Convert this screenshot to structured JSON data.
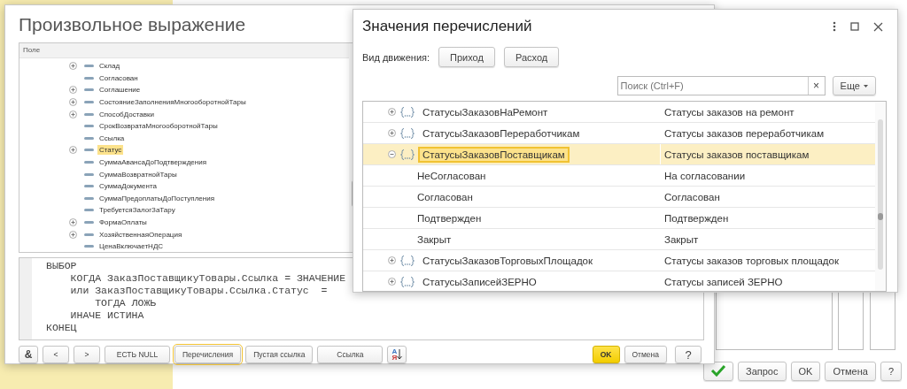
{
  "background_window": {
    "buttons": [
      {
        "kind": "check"
      },
      {
        "kind": "text",
        "label": "Запрос"
      },
      {
        "kind": "text",
        "label": "OK"
      },
      {
        "kind": "text",
        "label": "Отмена"
      },
      {
        "kind": "text",
        "label": "?"
      }
    ]
  },
  "expression_dialog": {
    "title": "Произвольное выражение",
    "tree": {
      "column": "Поле",
      "items": [
        {
          "label": "Склад",
          "expandable": true,
          "selected": false
        },
        {
          "label": "Согласован",
          "expandable": false,
          "selected": false
        },
        {
          "label": "Соглашение",
          "expandable": true,
          "selected": false
        },
        {
          "label": "СостояниеЗаполненияМногооборотнойТары",
          "expandable": true,
          "selected": false
        },
        {
          "label": "СпособДоставки",
          "expandable": true,
          "selected": false
        },
        {
          "label": "СрокВозвратаМногооборотнойТары",
          "expandable": false,
          "selected": false
        },
        {
          "label": "Ссылка",
          "expandable": false,
          "selected": false
        },
        {
          "label": "Статус",
          "expandable": true,
          "selected": true
        },
        {
          "label": "СуммаАвансаДоПодтверждения",
          "expandable": false,
          "selected": false
        },
        {
          "label": "СуммаВозвратнойТары",
          "expandable": false,
          "selected": false
        },
        {
          "label": "СуммаДокумента",
          "expandable": false,
          "selected": false
        },
        {
          "label": "СуммаПредоплатыДоПоступления",
          "expandable": false,
          "selected": false
        },
        {
          "label": "ТребуетсяЗалогЗаТару",
          "expandable": false,
          "selected": false
        },
        {
          "label": "ФормаОплаты",
          "expandable": true,
          "selected": false
        },
        {
          "label": "ХозяйственнаяОперация",
          "expandable": true,
          "selected": false
        },
        {
          "label": "ЦенаВключаетНДС",
          "expandable": false,
          "selected": false
        }
      ]
    },
    "code_lines": [
      "ВЫБОР",
      "    КОГДА ЗаказПоставщикуТовары.Ссылка = ЗНАЧЕНИЕ",
      "    или ЗаказПоставщикуТовары.Ссылка.Статус  =",
      "        ТОГДА ЛОЖЬ",
      "    ИНАЧЕ ИСТИНА",
      "КОНЕЦ"
    ],
    "toolbar": [
      {
        "kind": "text",
        "label": "&",
        "focused": false
      },
      {
        "kind": "text",
        "label": "<",
        "focused": false
      },
      {
        "kind": "text",
        "label": ">",
        "focused": false
      },
      {
        "kind": "text",
        "label": "ЕСТЬ NULL",
        "focused": false
      },
      {
        "kind": "text",
        "label": "Перечисления",
        "focused": true
      },
      {
        "kind": "text",
        "label": "Пустая ссылка",
        "focused": false
      },
      {
        "kind": "text",
        "label": "Ссылка",
        "focused": false
      },
      {
        "kind": "sort",
        "letters": [
          "А",
          "Я"
        ],
        "focused": false
      }
    ],
    "footer_buttons": [
      {
        "label": "OK",
        "default": true
      },
      {
        "label": "Отмена",
        "default": false
      },
      {
        "label": "?",
        "default": false
      }
    ]
  },
  "enum_dialog": {
    "title": "Значения перечислений",
    "filter_label": "Вид движения:",
    "filter_buttons": [
      "Приход",
      "Расход"
    ],
    "search": {
      "placeholder": "Поиск (Ctrl+F)"
    },
    "clear": "×",
    "more": "Еще",
    "rows": [
      {
        "name": "СтатусыЗаказовНаРемонт",
        "presentation": "Статусы заказов на ремонт",
        "expanded": false,
        "selected": false,
        "children": []
      },
      {
        "name": "СтатусыЗаказовПереработчикам",
        "presentation": "Статусы заказов переработчикам",
        "expanded": false,
        "selected": false,
        "children": []
      },
      {
        "name": "СтатусыЗаказовПоставщикам",
        "presentation": "Статусы заказов поставщикам",
        "expanded": true,
        "selected": true,
        "children": [
          {
            "name": "НеСогласован",
            "presentation": "На согласовании"
          },
          {
            "name": "Согласован",
            "presentation": "Согласован"
          },
          {
            "name": "Подтвержден",
            "presentation": "Подтвержден"
          },
          {
            "name": "Закрыт",
            "presentation": "Закрыт"
          }
        ]
      },
      {
        "name": "СтатусыЗаказовТорговыхПлощадок",
        "presentation": "Статусы заказов торговых площадок",
        "expanded": false,
        "selected": false,
        "children": []
      },
      {
        "name": "СтатусыЗаписейЗЕРНО",
        "presentation": "Статусы записей ЗЕРНО",
        "expanded": false,
        "selected": false,
        "children": []
      }
    ]
  }
}
